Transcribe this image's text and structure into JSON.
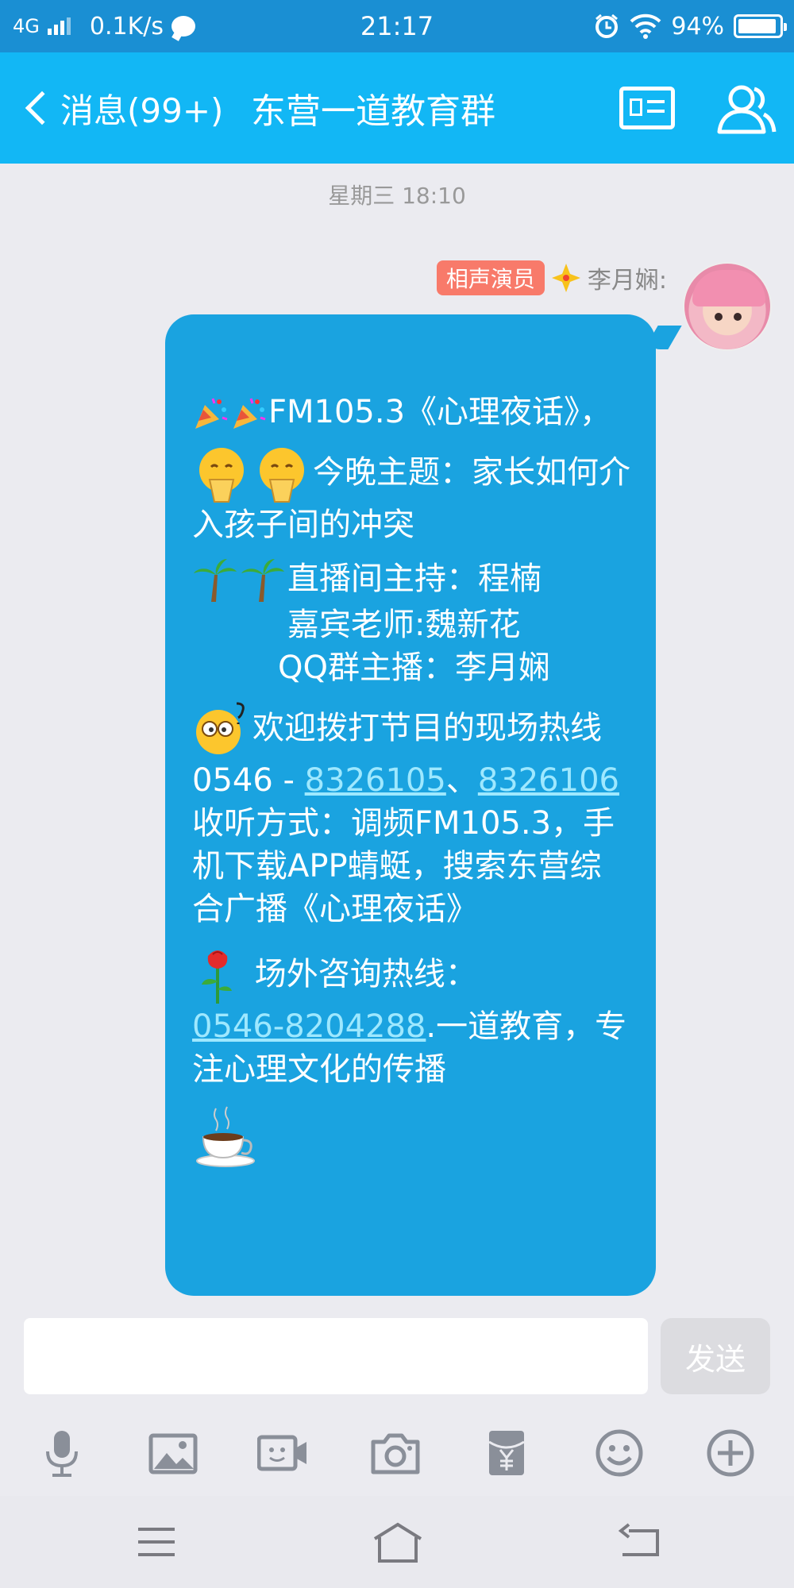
{
  "status_bar": {
    "network": "4G",
    "speed": "0.1K/s",
    "time": "21:17",
    "battery": "94%",
    "battery_level": 0.94
  },
  "header": {
    "back_label": "消息(99+)",
    "title": "东营一道教育群"
  },
  "chat": {
    "timestamp": "星期三 18:10",
    "message": {
      "sender_badge": "相声演员",
      "sender_name": "李月娴:",
      "line1": "FM105.3《心理夜话》，",
      "line2": "今晚主题：家长如何介入孩子间的冲突",
      "line3": "直播间主持：程楠",
      "line4": "嘉宾老师:魏新花",
      "line5": "QQ群主播：李月娴",
      "line6a": "欢迎拨打节目的现场热线0546 - ",
      "phone1": "8326105",
      "sep": "、",
      "phone2": "8326106",
      "line7": "收听方式：调频FM105.3，手机下载APP蜻蜓，搜索东营综合广播《心理夜话》",
      "line8a": "场外咨询热线：",
      "phone3": "0546-8204288",
      "line8b": ".一道教育，专注心理文化的传播"
    }
  },
  "input": {
    "value": "",
    "send_label": "发送"
  },
  "colors": {
    "status_bar": "#1a8fd3",
    "header": "#12b7f5",
    "bubble": "#1aa3e0",
    "badge": "#f87a6a"
  }
}
